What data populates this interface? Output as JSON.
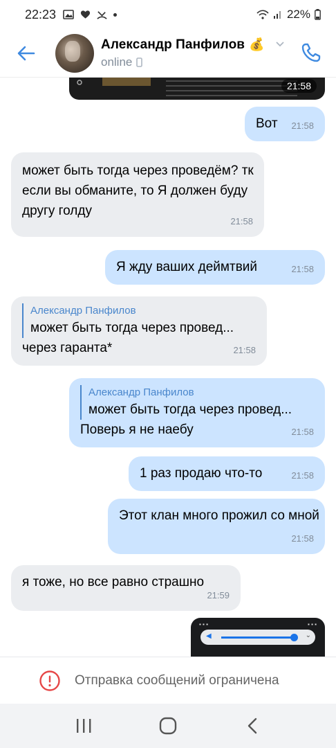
{
  "status_bar": {
    "time": "22:23",
    "battery": "22%"
  },
  "header": {
    "contact_name": "Александр Панфилов",
    "name_emoji": "💰",
    "status": "online",
    "icons": [
      "back-arrow-icon",
      "phone-icon",
      "chevron-down-icon",
      "mobile-icon"
    ]
  },
  "images": {
    "top_time": "21:58"
  },
  "messages": [
    {
      "dir": "out",
      "text": "Вот",
      "time": "21:58"
    },
    {
      "dir": "in",
      "text": "может быть тогда через проведём? тк если вы обманите, то Я должен буду другу голду",
      "time": "21:58"
    },
    {
      "dir": "out",
      "text": "Я жду ваших деймтвий",
      "time": "21:58"
    },
    {
      "dir": "in",
      "quote_author": "Александр Панфилов",
      "quote_text": "может быть тогда через провед...",
      "text": "через гаранта*",
      "time": "21:58"
    },
    {
      "dir": "out",
      "quote_author": "Александр Панфилов",
      "quote_text": "может быть тогда через провед...",
      "text": "Поверь я не наебу",
      "time": "21:58"
    },
    {
      "dir": "out",
      "text": "1 раз продаю что-то",
      "time": "21:58"
    },
    {
      "dir": "out",
      "text": "Этот клан много прожил со мной",
      "time": "21:58"
    },
    {
      "dir": "in",
      "text": "я тоже, но все равно страшно",
      "time": "21:59"
    }
  ],
  "restriction": {
    "text": "Отправка сообщений ограничена"
  },
  "colors": {
    "accent": "#4986cc",
    "bubble_out": "#cce4ff",
    "bubble_in": "#ebedf0",
    "warning": "#e64646"
  }
}
